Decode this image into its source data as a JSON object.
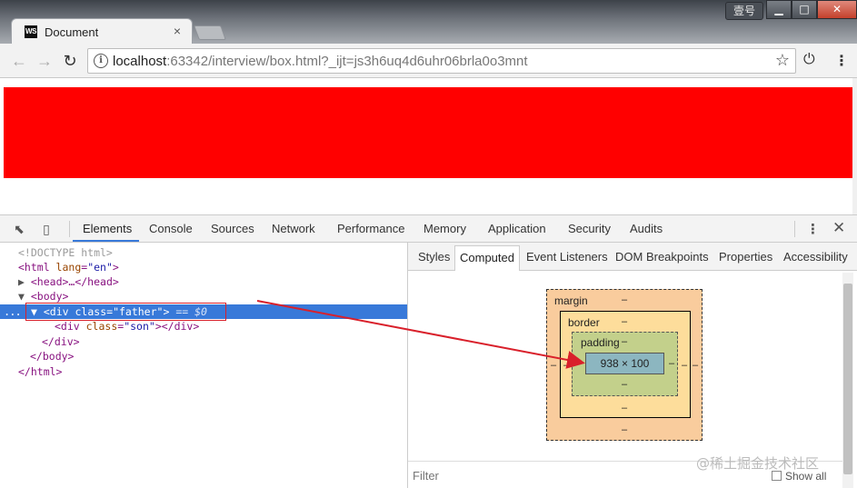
{
  "window": {
    "tab_title": "Document",
    "tab_favicon_text": "WS",
    "tab_close": "×",
    "user_button": "壹号",
    "min_symbol": "▁",
    "max_symbol": "□",
    "close_symbol": "✕"
  },
  "toolbar": {
    "back_icon": "←",
    "forward_icon": "→",
    "reload_icon": "↻",
    "url_host": "localhost",
    "url_rest": ":63342/interview/box.html?_ijt=js3h6uq4d6uhr06brla0o3mnt",
    "star_icon": "☆",
    "power_icon": "⏻",
    "menu_icon": "⋮"
  },
  "page": {
    "box_color": "#ff0000"
  },
  "devtools": {
    "tabs": [
      "Elements",
      "Console",
      "Sources",
      "Network",
      "Performance",
      "Memory",
      "Application",
      "Security",
      "Audits"
    ],
    "active_tab": "Elements",
    "more_icon": "⋮",
    "close_icon": "✕",
    "dom": {
      "doctype": "<!DOCTYPE html>",
      "html_open_tag": "<html",
      "html_lang_attr": " lang",
      "html_lang_val": "\"en\"",
      "head_collapsed": "<head>…</head>",
      "body_open": "<body>",
      "div_father_open": "<div",
      "div_father_attr": " class",
      "div_father_val": "\"father\"",
      "div_father_close": ">",
      "selected_marker": "== $0",
      "div_son_open": "<div",
      "div_son_attr": " class",
      "div_son_val": "\"son\"",
      "div_son_rest": "></div>",
      "div_close": "</div>",
      "body_close": "</body>",
      "html_close": "</html>",
      "ellipsis": "..."
    },
    "side_tabs": [
      "Styles",
      "Computed",
      "Event Listeners",
      "DOM Breakpoints",
      "Properties",
      "Accessibility"
    ],
    "active_side_tab": "Computed",
    "box_model": {
      "margin_label": "margin",
      "border_label": "border",
      "padding_label": "padding",
      "content_size": "938 × 100",
      "dash": "–"
    },
    "filter_placeholder": "Filter",
    "show_all": "Show all"
  },
  "watermark": "@稀土掘金技术社区"
}
